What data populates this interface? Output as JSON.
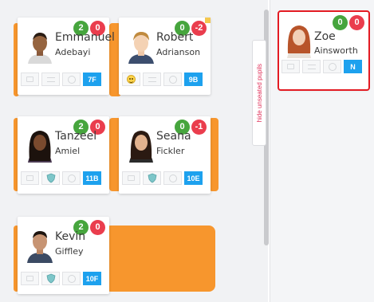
{
  "hide_tab_label": "hide unseated pupils",
  "pupils": [
    {
      "id": "emmanuel",
      "first": "Emmanuel",
      "last": "Adebayi",
      "pos": "2",
      "neg": "0",
      "group": "7F"
    },
    {
      "id": "robert",
      "first": "Robert",
      "last": "Adrianson",
      "pos": "0",
      "neg": "-2",
      "group": "9B"
    },
    {
      "id": "tanzeel",
      "first": "Tanzeel",
      "last": "Amiel",
      "pos": "2",
      "neg": "0",
      "group": "11B"
    },
    {
      "id": "seana",
      "first": "Seana",
      "last": "Fickler",
      "pos": "0",
      "neg": "-1",
      "group": "10E"
    },
    {
      "id": "kevin",
      "first": "Kevin",
      "last": "Giffley",
      "pos": "2",
      "neg": "0",
      "group": "10F"
    }
  ],
  "unseated": [
    {
      "id": "zoe",
      "first": "Zoe",
      "last": "Ainsworth",
      "pos": "0",
      "neg": "0",
      "group": "N"
    }
  ],
  "colors": {
    "desk": "#f7962d",
    "positive_badge": "#46a53d",
    "negative_badge": "#ea3d4d",
    "group_tag": "#1da1ee",
    "selection_outline": "#e31b23",
    "hide_tab_text": "#e0325b"
  }
}
